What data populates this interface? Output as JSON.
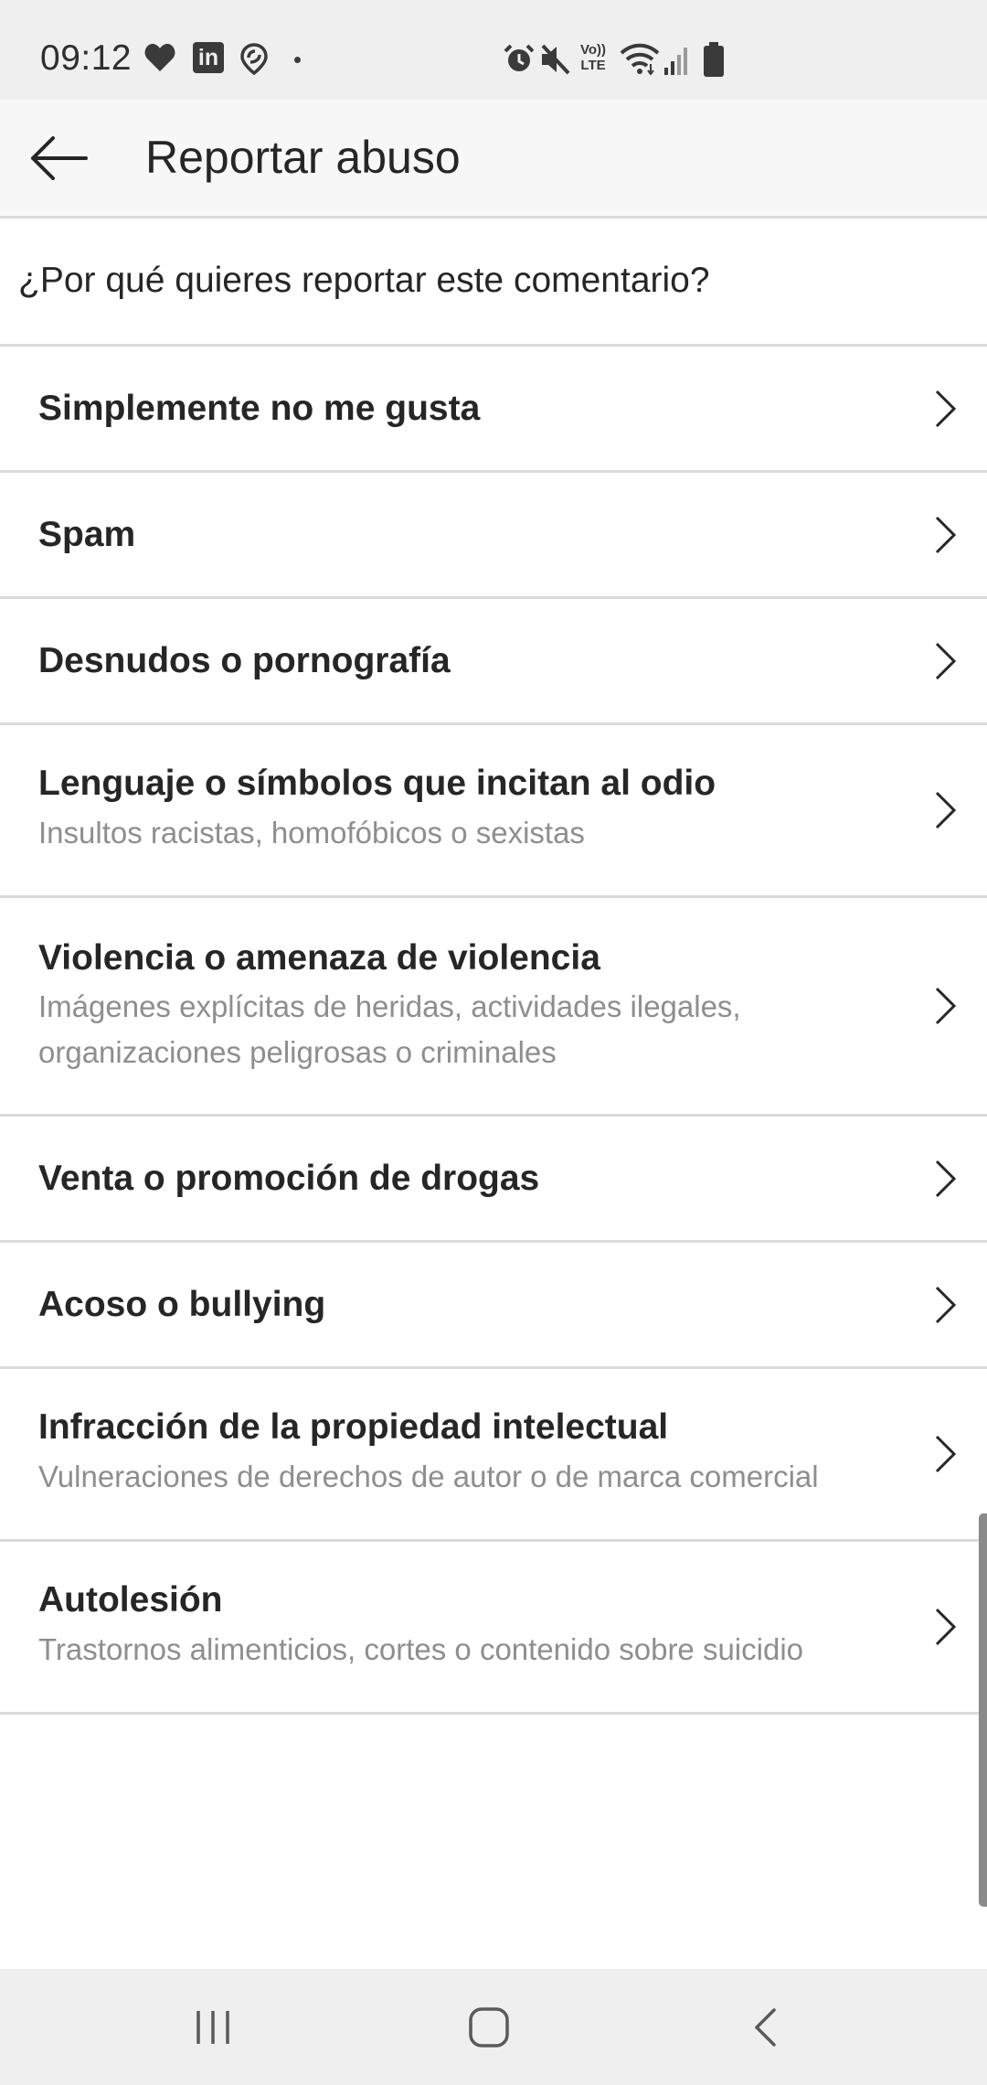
{
  "status_bar": {
    "time": "09:12",
    "icons": [
      "heart-icon",
      "linkedin-icon",
      "location-app-icon",
      "dot-icon",
      "alarm-icon",
      "mute-icon",
      "volte-icon",
      "wifi-icon",
      "signal-icon",
      "battery-icon"
    ],
    "volte_label_top": "Vo))",
    "volte_label_bottom": "LTE",
    "linkedin_label": "in"
  },
  "app_bar": {
    "title": "Reportar abuso",
    "back_icon": "arrow-left-icon"
  },
  "question": "¿Por qué quieres reportar este comentario?",
  "reasons": [
    {
      "title": "Simplemente no me gusta",
      "subtitle": ""
    },
    {
      "title": "Spam",
      "subtitle": ""
    },
    {
      "title": "Desnudos o pornografía",
      "subtitle": ""
    },
    {
      "title": "Lenguaje o símbolos que incitan al odio",
      "subtitle": "Insultos racistas, homofóbicos o sexistas"
    },
    {
      "title": "Violencia o amenaza de violencia",
      "subtitle": "Imágenes explícitas de heridas, actividades ilegales,\norganizaciones peligrosas o criminales"
    },
    {
      "title": "Venta o promoción de drogas",
      "subtitle": ""
    },
    {
      "title": "Acoso o bullying",
      "subtitle": ""
    },
    {
      "title": "Infracción de la propiedad intelectual",
      "subtitle": "Vulneraciones de derechos de autor o de marca comercial"
    },
    {
      "title": "Autolesión",
      "subtitle": "Trastornos alimenticios, cortes o contenido sobre suicidio"
    }
  ],
  "nav_bar": {
    "buttons": [
      "recent-apps-icon",
      "home-icon",
      "back-icon"
    ]
  },
  "colors": {
    "status_bar_bg": "#efefef",
    "app_bar_bg": "#f7f7f7",
    "text_primary": "#262626",
    "text_secondary": "#8e8e8e",
    "divider": "#dbdbdb"
  }
}
